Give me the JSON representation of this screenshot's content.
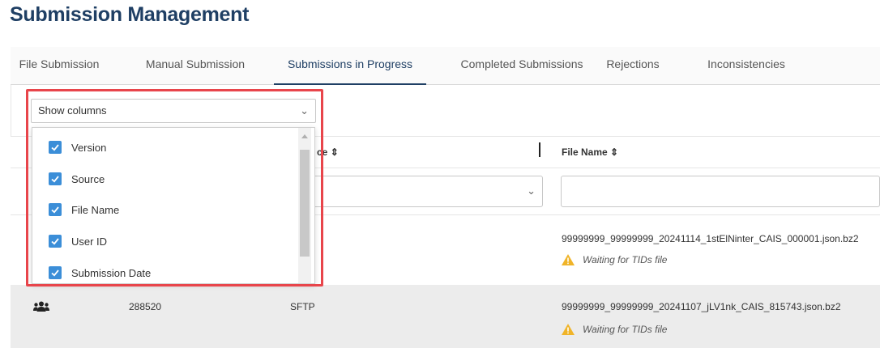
{
  "page": {
    "title": "Submission Management"
  },
  "tabs": [
    {
      "label": "File Submission"
    },
    {
      "label": "Manual Submission"
    },
    {
      "label": "Submissions in Progress"
    },
    {
      "label": "Completed Submissions"
    },
    {
      "label": "Rejections"
    },
    {
      "label": "Inconsistencies"
    }
  ],
  "active_tab": "Submissions in Progress",
  "column_picker": {
    "label": "Show columns",
    "options": [
      {
        "label": "Version",
        "checked": true
      },
      {
        "label": "Source",
        "checked": true
      },
      {
        "label": "File Name",
        "checked": true
      },
      {
        "label": "User ID",
        "checked": true
      },
      {
        "label": "Submission Date",
        "checked": true
      }
    ]
  },
  "table": {
    "headers": {
      "source_partial": "ce",
      "file_name": "File Name"
    },
    "rows": [
      {
        "file_name": "99999999_99999999_20241114_1stElNinter_CAIS_000001.json.bz2",
        "status": "Waiting for TIDs file"
      },
      {
        "id": "288520",
        "source": "SFTP",
        "file_name": "99999999_99999999_20241107_jLV1nk_CAIS_815743.json.bz2",
        "status": "Waiting for TIDs file"
      }
    ]
  },
  "icons": {
    "warning": "warning-icon",
    "users": "users-icon",
    "sort": "sort-icon",
    "chevron": "chevron-down-icon"
  },
  "colors": {
    "title": "#1f3f64",
    "checkbox": "#3b8ed8",
    "highlight": "#e8454b",
    "warning": "#f0b429"
  }
}
